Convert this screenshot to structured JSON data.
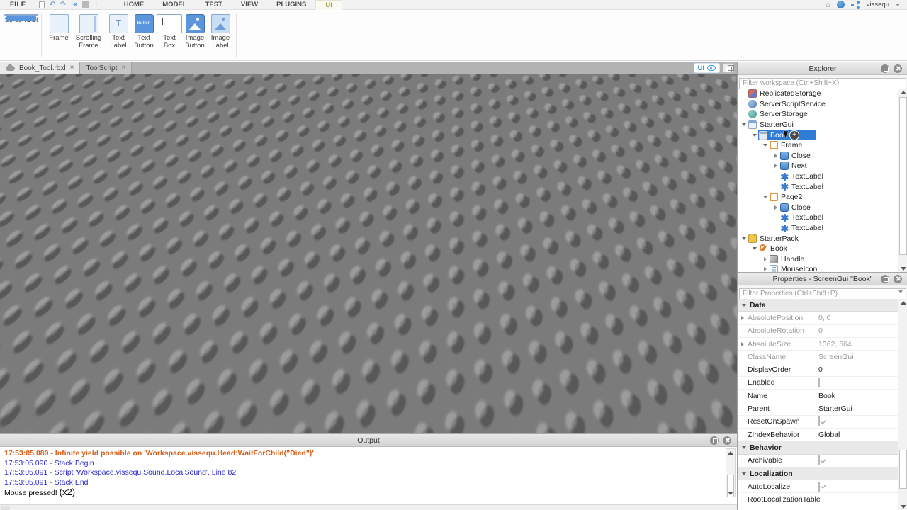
{
  "app": {
    "account_name": "vissequ"
  },
  "ribbon": {
    "file_label": "FILE",
    "menu_tabs": [
      {
        "label": "HOME"
      },
      {
        "label": "MODEL"
      },
      {
        "label": "TEST"
      },
      {
        "label": "VIEW"
      },
      {
        "label": "PLUGINS"
      },
      {
        "label": "UI",
        "active": true
      }
    ],
    "active_tab_color": "#9fa03e",
    "tools": [
      {
        "label": "ScreenGUI"
      },
      {
        "label": "Frame"
      },
      {
        "label": "Scrolling\nFrame"
      },
      {
        "label": "Text\nLabel"
      },
      {
        "label": "Text\nButton",
        "icon_text": "Button"
      },
      {
        "label": "Text\nBox"
      },
      {
        "label": "Image\nButton"
      },
      {
        "label": "Image\nLabel"
      }
    ]
  },
  "doc_tabs": [
    {
      "label": "Book_Tool.rbxl",
      "close": "×",
      "active": true
    },
    {
      "label": "ToolScript",
      "close": "×",
      "active": false
    }
  ],
  "viewport": {
    "overlay": {
      "ui_label": "UI"
    }
  },
  "explorer": {
    "title": "Explorer",
    "filter_placeholder": "Filter workspace (Ctrl+Shift+X)",
    "selection_color": "#2e7cd6",
    "tree": [
      {
        "label": "ReplicatedStorage",
        "icon": "replicated-storage",
        "level": 0
      },
      {
        "label": "ServerScriptService",
        "icon": "server-script-service",
        "level": 0
      },
      {
        "label": "ServerStorage",
        "icon": "server-storage",
        "level": 0
      },
      {
        "label": "StarterGui",
        "icon": "starter-gui",
        "level": 0,
        "expander": "open"
      },
      {
        "label": "Book",
        "icon": "screen-gui",
        "level": 1,
        "expander": "open",
        "selected": true
      },
      {
        "label": "Frame",
        "icon": "frame",
        "level": 2,
        "expander": "open"
      },
      {
        "label": "Close",
        "icon": "text-button",
        "level": 3,
        "expander": "closed"
      },
      {
        "label": "Next",
        "icon": "text-button",
        "level": 3,
        "expander": "closed"
      },
      {
        "label": "TextLabel",
        "icon": "text-label",
        "level": 3
      },
      {
        "label": "TextLabel",
        "icon": "text-label",
        "level": 3
      },
      {
        "label": "Page2",
        "icon": "frame",
        "level": 2,
        "expander": "open"
      },
      {
        "label": "Close",
        "icon": "text-button",
        "level": 3,
        "expander": "closed"
      },
      {
        "label": "TextLabel",
        "icon": "text-label",
        "level": 3
      },
      {
        "label": "TextLabel",
        "icon": "text-label",
        "level": 3
      },
      {
        "label": "StarterPack",
        "icon": "starter-pack",
        "level": 0,
        "expander": "open"
      },
      {
        "label": "Book",
        "icon": "tool",
        "level": 1,
        "expander": "open"
      },
      {
        "label": "Handle",
        "icon": "part",
        "level": 2,
        "expander": "closed"
      },
      {
        "label": "MouseIcon",
        "icon": "script",
        "level": 2,
        "clipped": true
      }
    ]
  },
  "properties": {
    "title": "Properties - ScreenGui \"Book\"",
    "filter_placeholder": "Filter Properties (Ctrl+Shift+P)",
    "rows": [
      {
        "kind": "section",
        "name": "Data"
      },
      {
        "kind": "prop",
        "name": "AbsolutePosition",
        "value": "0, 0",
        "readonly": true,
        "expandable": true
      },
      {
        "kind": "prop",
        "name": "AbsoluteRotation",
        "value": "0",
        "readonly": true
      },
      {
        "kind": "prop",
        "name": "AbsoluteSize",
        "value": "1362, 664",
        "readonly": true,
        "expandable": true
      },
      {
        "kind": "prop",
        "name": "ClassName",
        "value": "ScreenGui",
        "readonly": true
      },
      {
        "kind": "prop",
        "name": "DisplayOrder",
        "value": "0"
      },
      {
        "kind": "prop",
        "name": "Enabled",
        "checkbox": true,
        "checked": false
      },
      {
        "kind": "prop",
        "name": "Name",
        "value": "Book"
      },
      {
        "kind": "prop",
        "name": "Parent",
        "value": "StarterGui"
      },
      {
        "kind": "prop",
        "name": "ResetOnSpawn",
        "checkbox": true,
        "checked": true
      },
      {
        "kind": "prop",
        "name": "ZIndexBehavior",
        "value": "Global"
      },
      {
        "kind": "section",
        "name": "Behavior"
      },
      {
        "kind": "prop",
        "name": "Archivable",
        "checkbox": true,
        "checked": true
      },
      {
        "kind": "section",
        "name": "Localization"
      },
      {
        "kind": "prop",
        "name": "AutoLocalize",
        "checkbox": true,
        "checked": true
      },
      {
        "kind": "prop",
        "name": "RootLocalizationTable",
        "value": ""
      }
    ]
  },
  "output": {
    "title": "Output",
    "colors": {
      "warning": "#d95f18",
      "info": "#2a2ace",
      "print": "#000000"
    },
    "lines": [
      {
        "kind": "warning",
        "text": "17:53:05.089 - Infinite yield possible on 'Workspace.vissequ.Head:WaitForChild(\"Died\")'"
      },
      {
        "kind": "info",
        "text": "17:53:05.090 - Stack Begin"
      },
      {
        "kind": "info",
        "text": "17:53:05.091 - Script 'Workspace.vissequ.Sound.LocalSound', Line 82"
      },
      {
        "kind": "info",
        "text": "17:53:05.091 - Stack End"
      },
      {
        "kind": "print",
        "text": "Mouse pressed!",
        "count": "(x2)"
      }
    ]
  }
}
